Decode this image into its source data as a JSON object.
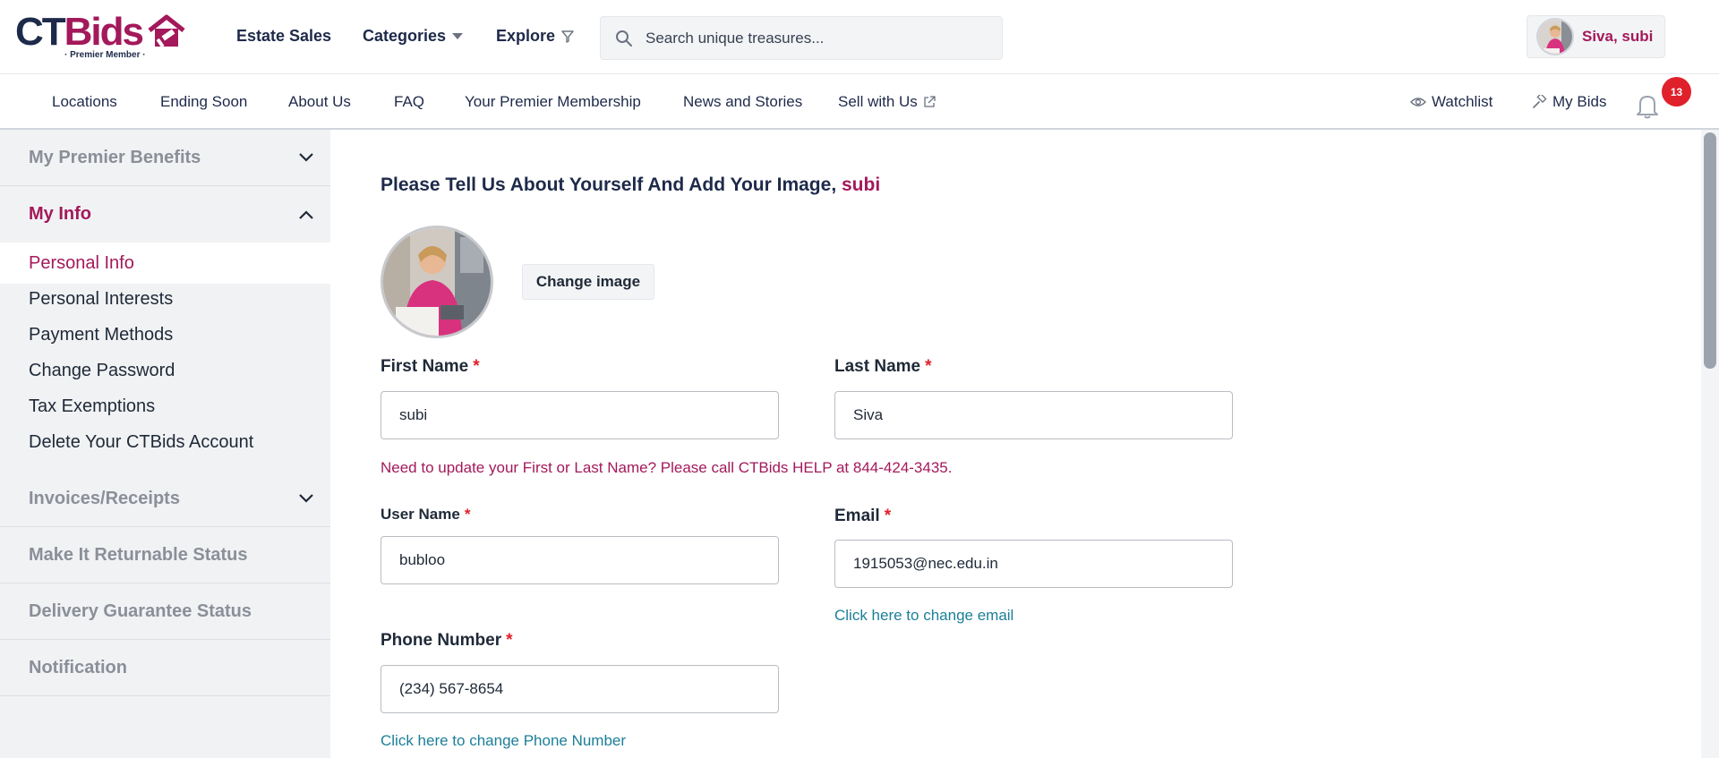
{
  "brand": {
    "logo_primary": "CT",
    "logo_secondary": "Bids",
    "logo_subtitle": "· Premier Member ·",
    "primary_color": "#1e2a4a",
    "accent_color": "#a3195b"
  },
  "header": {
    "nav": [
      {
        "label": "Estate Sales",
        "icon": ""
      },
      {
        "label": "Categories",
        "icon": "caret-down-icon"
      },
      {
        "label": "Explore",
        "icon": "filter-icon"
      }
    ],
    "search": {
      "placeholder": "Search unique treasures...",
      "icon": "search-icon"
    },
    "user": {
      "name": "Siva, subi"
    }
  },
  "subnav": {
    "items": [
      "Locations",
      "Ending Soon",
      "About Us",
      "FAQ",
      "Your Premier Membership",
      "News and Stories",
      "Sell with Us"
    ],
    "watchlist_label": "Watchlist",
    "mybids_label": "My Bids",
    "notification_count": "13"
  },
  "sidebar": {
    "sections": {
      "premier": "My Premier Benefits",
      "myinfo": "My Info",
      "invoices": "Invoices/Receipts",
      "returnable": "Make It Returnable Status",
      "delivery": "Delivery Guarantee Status",
      "notification": "Notification"
    },
    "myinfo_links": [
      "Personal Info",
      "Personal Interests",
      "Payment Methods",
      "Change Password",
      "Tax Exemptions",
      "Delete Your CTBids Account"
    ],
    "current_link": "Personal Info"
  },
  "main": {
    "heading_prefix": "Please Tell Us About Yourself And Add Your Image,",
    "heading_name": "subi",
    "change_image_label": "Change image",
    "first_name": {
      "label": "First Name",
      "value": "subi"
    },
    "last_name": {
      "label": "Last Name",
      "value": "Siva"
    },
    "name_notice": "Need to update your First or Last Name? Please call CTBids HELP at 844-424-3435.",
    "user_name": {
      "label": "User Name",
      "value": "bubloo"
    },
    "email": {
      "label": "Email",
      "value": "1915053@nec.edu.in"
    },
    "change_email_link": "Click here to change email",
    "phone": {
      "label": "Phone Number",
      "value": "(234) 567-8654"
    },
    "change_phone_link": "Click here to change Phone Number",
    "required_marker": "*"
  }
}
